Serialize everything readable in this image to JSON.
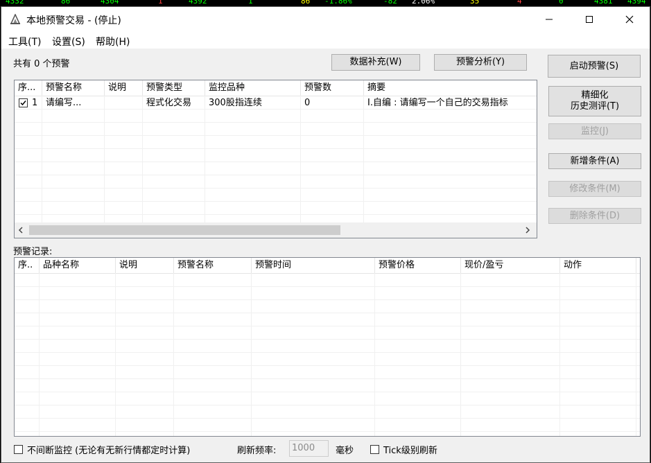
{
  "ticker": [
    {
      "text": "4332",
      "color": "#00ff00"
    },
    {
      "text": "86",
      "color": "#00ff00"
    },
    {
      "text": "4304",
      "color": "#00ff00"
    },
    {
      "text": "1",
      "color": "#ff4040"
    },
    {
      "text": "4392",
      "color": "#00ff00"
    },
    {
      "text": "1",
      "color": "#00ff00"
    },
    {
      "text": "86",
      "color": "#ffff00"
    },
    {
      "text": "-1.86%",
      "color": "#00ff00"
    },
    {
      "text": "-82",
      "color": "#00ff00"
    },
    {
      "text": "2.06%",
      "color": "#ffffff"
    },
    {
      "text": "35",
      "color": "#ffff00"
    },
    {
      "text": "4",
      "color": "#ff4040"
    },
    {
      "text": "0",
      "color": "#00ff00"
    },
    {
      "text": "4381",
      "color": "#00ff00"
    },
    {
      "text": "4394",
      "color": "#00ff00"
    }
  ],
  "window": {
    "title": "本地预警交易  - (停止)",
    "minimize_icon": "minimize-icon",
    "maximize_icon": "maximize-icon",
    "close_icon": "close-icon"
  },
  "menu": [
    "工具(T)",
    "设置(S)",
    "帮助(H)"
  ],
  "summary": "共有 0 个预警",
  "top_buttons": {
    "data_fill": "数据补充(W)",
    "analysis": "预警分析(Y)"
  },
  "side_buttons": {
    "start": "启动预警(S)",
    "backtest_line1": "精细化",
    "backtest_line2": "历史测评(T)",
    "monitor": "监控(J)",
    "add": "新增条件(A)",
    "modify": "修改条件(M)",
    "delete": "删除条件(D)"
  },
  "alerts_table": {
    "columns": [
      "序...",
      "预警名称",
      "说明",
      "预警类型",
      "监控品种",
      "预警数",
      "摘要"
    ],
    "rows": [
      {
        "checked": true,
        "index": "1",
        "name": "请编写...",
        "desc": "",
        "type": "程式化交易",
        "symbol": "300股指连续",
        "count": "0",
        "summary": "I.自编 : 请编写一个自己的交易指标"
      }
    ]
  },
  "records_label": "预警记录:",
  "records_table": {
    "columns": [
      "序..",
      "品种名称",
      "说明",
      "预警名称",
      "预警时间",
      "预警价格",
      "现价/盈亏",
      "动作"
    ],
    "rows": []
  },
  "footer": {
    "continuous_label": "不间断监控 (无论有无新行情都定时计算)",
    "continuous_checked": false,
    "refresh_label": "刷新频率:",
    "refresh_value": "1000",
    "refresh_unit": "毫秒",
    "tick_label": "Tick级别刷新",
    "tick_checked": false
  }
}
